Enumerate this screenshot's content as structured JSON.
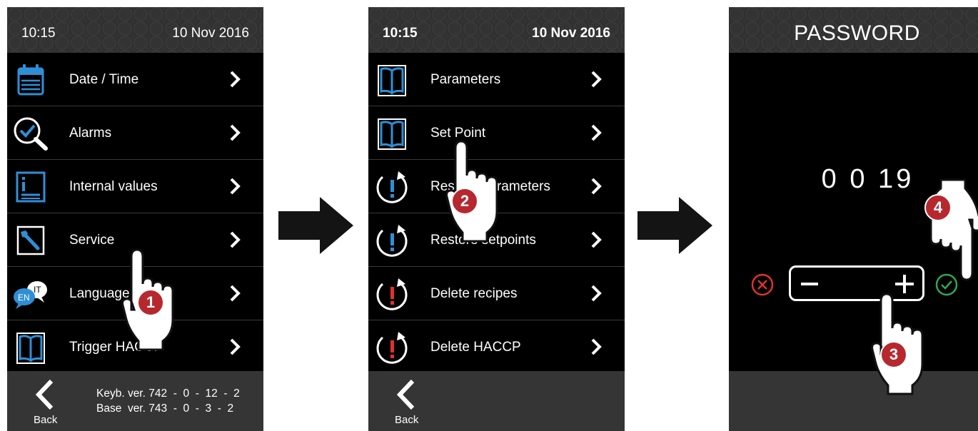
{
  "screen1": {
    "status": {
      "time": "10:15",
      "date": "10 Nov 2016"
    },
    "menu": [
      {
        "label": "Date / Time",
        "icon": "calendar-icon"
      },
      {
        "label": "Alarms",
        "icon": "magnifier-check-icon"
      },
      {
        "label": "Internal values",
        "icon": "info-list-icon"
      },
      {
        "label": "Service",
        "icon": "wrench-icon"
      },
      {
        "label": "Language",
        "icon": "language-bubbles-icon",
        "icon_text": {
          "primary": "EN",
          "secondary": "IT"
        }
      },
      {
        "label": "Trigger HACCP",
        "icon": "book-icon"
      }
    ],
    "footer": {
      "back_label": "Back",
      "version_lines": [
        "Keyb. ver. 742  -  0  -  12  -  2",
        "Base  ver. 743  -  0  -  3  -  2"
      ]
    }
  },
  "screen2": {
    "status": {
      "time": "10:15",
      "date": "10 Nov 2016"
    },
    "menu": [
      {
        "label": "Parameters",
        "icon": "book-icon"
      },
      {
        "label": "Set Point",
        "icon": "book-icon"
      },
      {
        "label": "Restore parameters",
        "icon": "restore-blue-icon"
      },
      {
        "label": "Restore setpoints",
        "icon": "restore-blue-icon"
      },
      {
        "label": "Delete recipes",
        "icon": "restore-red-icon"
      },
      {
        "label": "Delete HACCP",
        "icon": "restore-red-icon"
      }
    ],
    "footer": {
      "back_label": "Back"
    }
  },
  "screen3": {
    "title": "PASSWORD",
    "value": "0 0 19"
  },
  "steps": [
    "1",
    "2",
    "3",
    "4"
  ],
  "colors": {
    "accent_blue": "#2f8fd6",
    "step_red": "#b7282e",
    "cancel_red": "#e0322e",
    "ok_green": "#2fa84f",
    "statusbar": "#333333",
    "footer": "#353535"
  }
}
